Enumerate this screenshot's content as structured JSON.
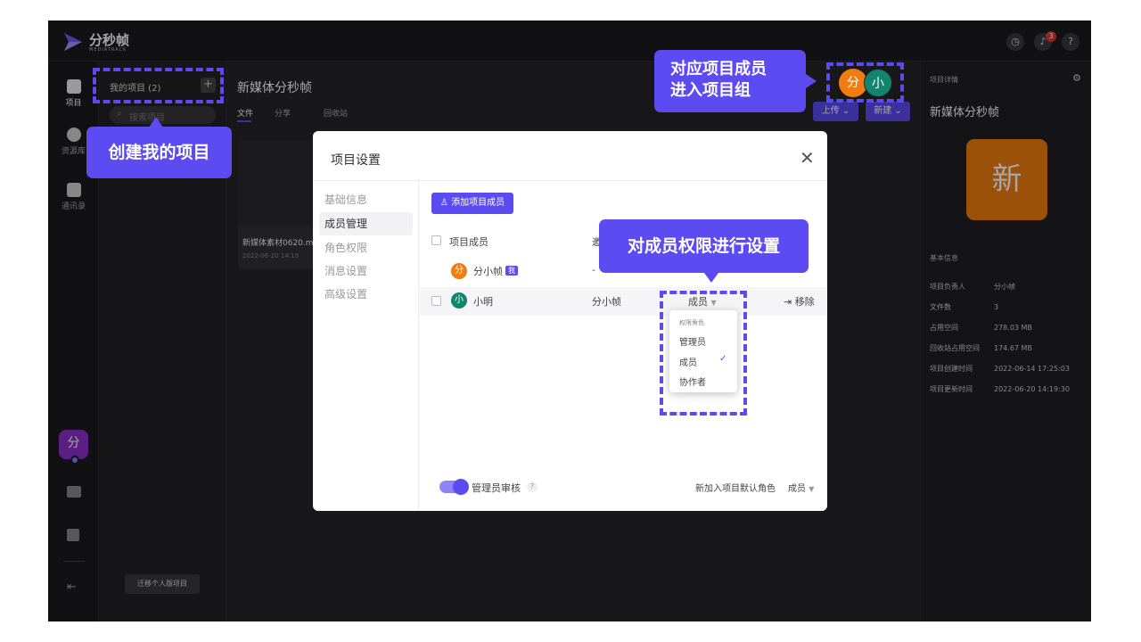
{
  "brand": {
    "name": "分秒帧",
    "subtitle": "MEDIATRACK"
  },
  "topbar": {
    "notif_count": "3",
    "help_label": "?"
  },
  "rail": {
    "items": [
      {
        "label": "项目",
        "icon": "project-icon"
      },
      {
        "label": "资源库",
        "icon": "library-icon"
      },
      {
        "label": "通讯录",
        "icon": "contacts-icon"
      }
    ],
    "avatar_label": "分",
    "collapse_glyph": "⇤"
  },
  "projects": {
    "header": "我的项目 (2)",
    "add_glyph": "+",
    "search_placeholder": "搜索项目",
    "migrate_label": "迁移个人版项目"
  },
  "main": {
    "title": "新媒体分秒帧",
    "tabs": [
      {
        "label": "文件"
      },
      {
        "label": "分享"
      },
      {
        "label": "回收站"
      }
    ],
    "toolbar": {
      "upload": "上传",
      "new": "新建"
    },
    "file_card": {
      "name": "新媒体素材0620.mp4",
      "date": "2022-06-20 14:19"
    },
    "member_avatars": [
      "分",
      "小"
    ]
  },
  "right_panel": {
    "header": "项目详情",
    "project_name": "新媒体分秒帧",
    "cover_char": "新",
    "section": "基本信息",
    "rows": [
      {
        "k": "项目负责人",
        "v": "分小帧"
      },
      {
        "k": "文件数",
        "v": "3"
      },
      {
        "k": "占用空间",
        "v": "278.03 MB"
      },
      {
        "k": "回收站占用空间",
        "v": "174.67 MB"
      },
      {
        "k": "项目创建时间",
        "v": "2022-06-14 17:25:03"
      },
      {
        "k": "项目更新时间",
        "v": "2022-06-20 14:19:30"
      }
    ]
  },
  "modal": {
    "title": "项目设置",
    "close": "✕",
    "side": [
      {
        "label": "基础信息"
      },
      {
        "label": "成员管理"
      },
      {
        "label": "角色权限"
      },
      {
        "label": "消息设置"
      },
      {
        "label": "高级设置"
      }
    ],
    "add_member": "添加项目成员",
    "col_member": "项目成员",
    "col_invite": "邀",
    "members": [
      {
        "avatar": "分",
        "name": "分小帧",
        "tag": "我",
        "inviter": "-",
        "role": "",
        "remove": ""
      },
      {
        "avatar": "小",
        "name": "小明",
        "tag": "",
        "inviter": "分小帧",
        "role": "成员",
        "remove": "移除"
      }
    ],
    "dropdown": {
      "header": "权限角色",
      "options": [
        "管理员",
        "成员",
        "协作者"
      ],
      "check": "✓"
    },
    "admin_review": "管理员审核",
    "default_role_label": "新加入项目默认角色",
    "default_role_value": "成员"
  },
  "callouts": {
    "create": "创建我的项目",
    "enter": [
      "对应项目成员",
      "进入项目组"
    ],
    "perm": "对成员权限进行设置"
  },
  "colors": {
    "accent": "#5b4bf0",
    "orange": "#f07d12",
    "teal": "#12856f"
  }
}
